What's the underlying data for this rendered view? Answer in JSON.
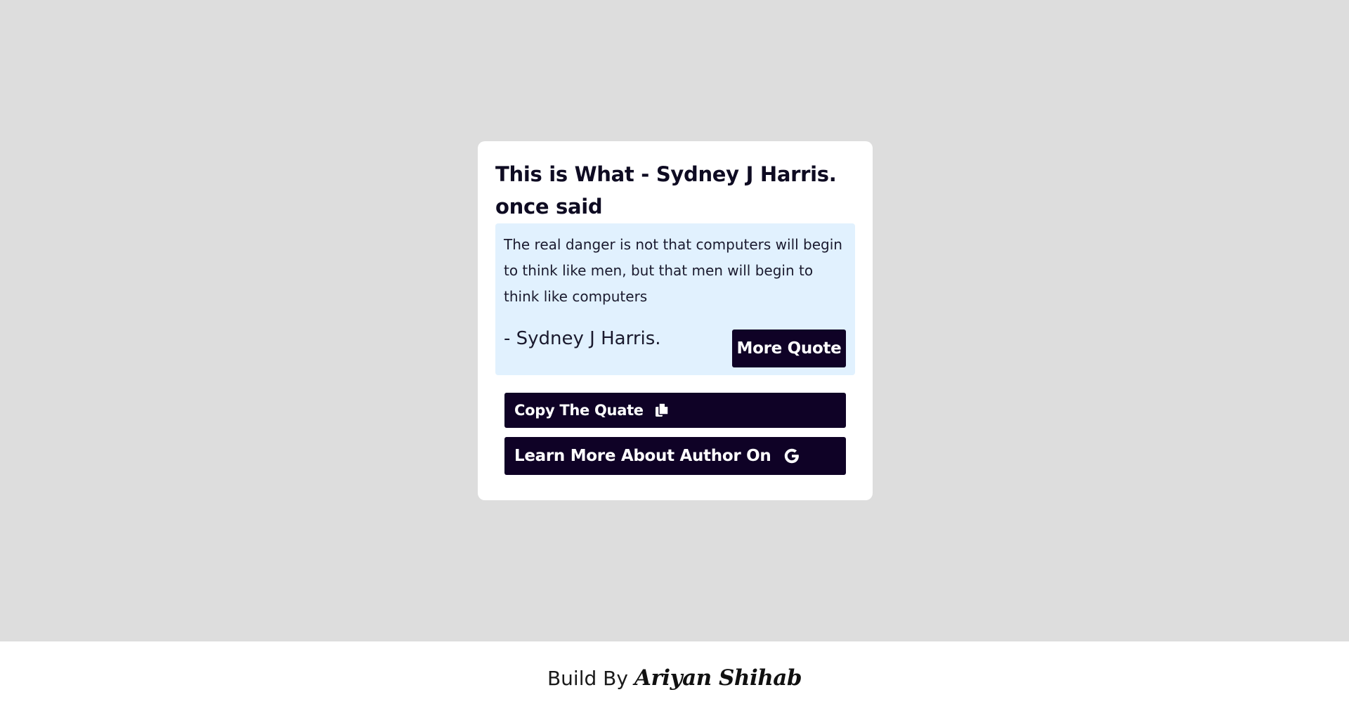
{
  "colors": {
    "page_background": "#dddddd",
    "card_background": "#ffffff",
    "quote_box_background": "#e1f1fe",
    "button_background": "#0f0226",
    "button_text": "#ffffff",
    "footer_background": "#ffffff"
  },
  "card": {
    "title": "This is What - Sydney J Harris. once said"
  },
  "quote": {
    "text": "The real danger is not that computers will begin to think like men, but that men will begin to think like computers",
    "author": "- Sydney J Harris."
  },
  "buttons": {
    "more_quote": "More Quote",
    "copy_quote": "Copy The Quate",
    "copy_icon": "copy-icon",
    "learn_more": "Learn More About Author On",
    "learn_more_icon": "google-icon"
  },
  "footer": {
    "label": "Build By",
    "name": "Ariyan Shihab"
  }
}
